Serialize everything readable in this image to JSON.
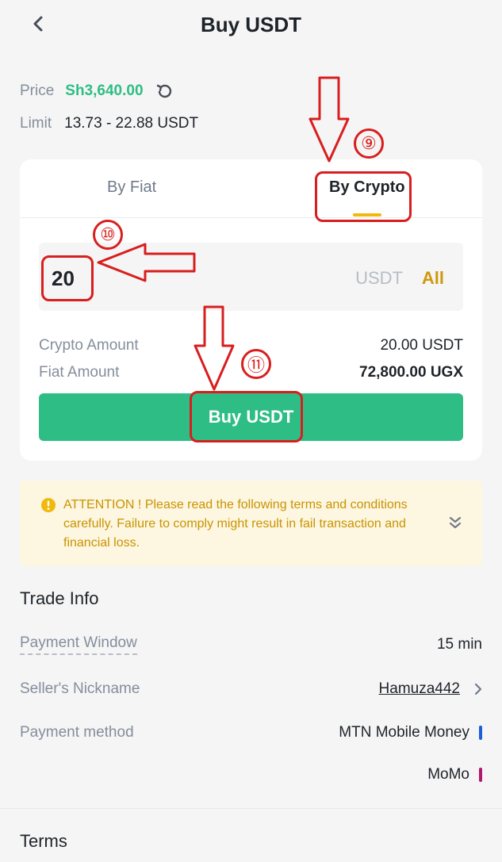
{
  "header": {
    "title": "Buy USDT",
    "back_icon": "chevron-left-icon"
  },
  "price": {
    "label": "Price",
    "value": "Sh3,640.00",
    "refresh_icon": "refresh-icon"
  },
  "limit": {
    "label": "Limit",
    "value": "13.73 - 22.88 USDT"
  },
  "tabs": [
    {
      "label": "By Fiat",
      "active": false
    },
    {
      "label": "By Crypto",
      "active": true
    }
  ],
  "amount": {
    "value": "20",
    "unit": "USDT",
    "all_label": "All"
  },
  "summary": {
    "crypto_label": "Crypto Amount",
    "crypto_value": "20.00 USDT",
    "fiat_label": "Fiat Amount",
    "fiat_value": "72,800.00 UGX"
  },
  "buy_button": {
    "label": "Buy USDT"
  },
  "attention": {
    "text": "ATTENTION ! Please read the following terms and conditions carefully. Failure to comply might result in fail transaction and financial loss."
  },
  "trade_info": {
    "title": "Trade Info",
    "payment_window": {
      "label": "Payment Window",
      "value": "15 min"
    },
    "seller": {
      "label": "Seller's Nickname",
      "value": "Hamuza442"
    },
    "payment_method": {
      "label": "Payment method",
      "methods": [
        "MTN Mobile Money",
        "MoMo"
      ]
    }
  },
  "terms": {
    "title": "Terms"
  },
  "annotations": {
    "step_9": "⑨",
    "step_10": "⑩",
    "step_11": "⑪"
  },
  "colors": {
    "accent_green": "#2ebd85",
    "accent_yellow": "#f0b90b",
    "annotation_red": "#d81e1e",
    "mtn_bar": "#1a5fd6",
    "momo_bar": "#b0186e"
  }
}
